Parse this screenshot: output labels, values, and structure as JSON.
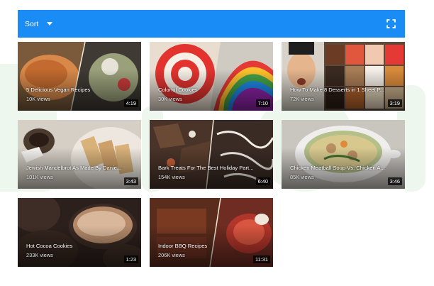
{
  "toolbar": {
    "sort_label": "Sort",
    "sort_icon": "caret-down-icon",
    "fullscreen_icon": "fullscreen-icon",
    "color": "#1a8cf5"
  },
  "videos": [
    {
      "title": "5 Delicious Vegan Recipes",
      "views": "10K views",
      "duration": "4:19"
    },
    {
      "title": "Colorful Cookies",
      "views": "30K views",
      "duration": "7:10"
    },
    {
      "title": "How To Make 8 Desserts in 1 Sheet P...",
      "views": "72K views",
      "duration": "3:19"
    },
    {
      "title": "Jewish Mandelbrot As Made By Danie...",
      "views": "101K views",
      "duration": "3:43"
    },
    {
      "title": "Bark Treats For The Best Holiday Part...",
      "views": "154K views",
      "duration": "6:40"
    },
    {
      "title": "Chicken Meatball Soup Vs. Chicken A...",
      "views": "85K views",
      "duration": "3:46"
    },
    {
      "title": "Hot Cocoa Cookies",
      "views": "233K views",
      "duration": "1:23"
    },
    {
      "title": "Indoor BBQ Recipes",
      "views": "206K views",
      "duration": "11:31"
    }
  ]
}
